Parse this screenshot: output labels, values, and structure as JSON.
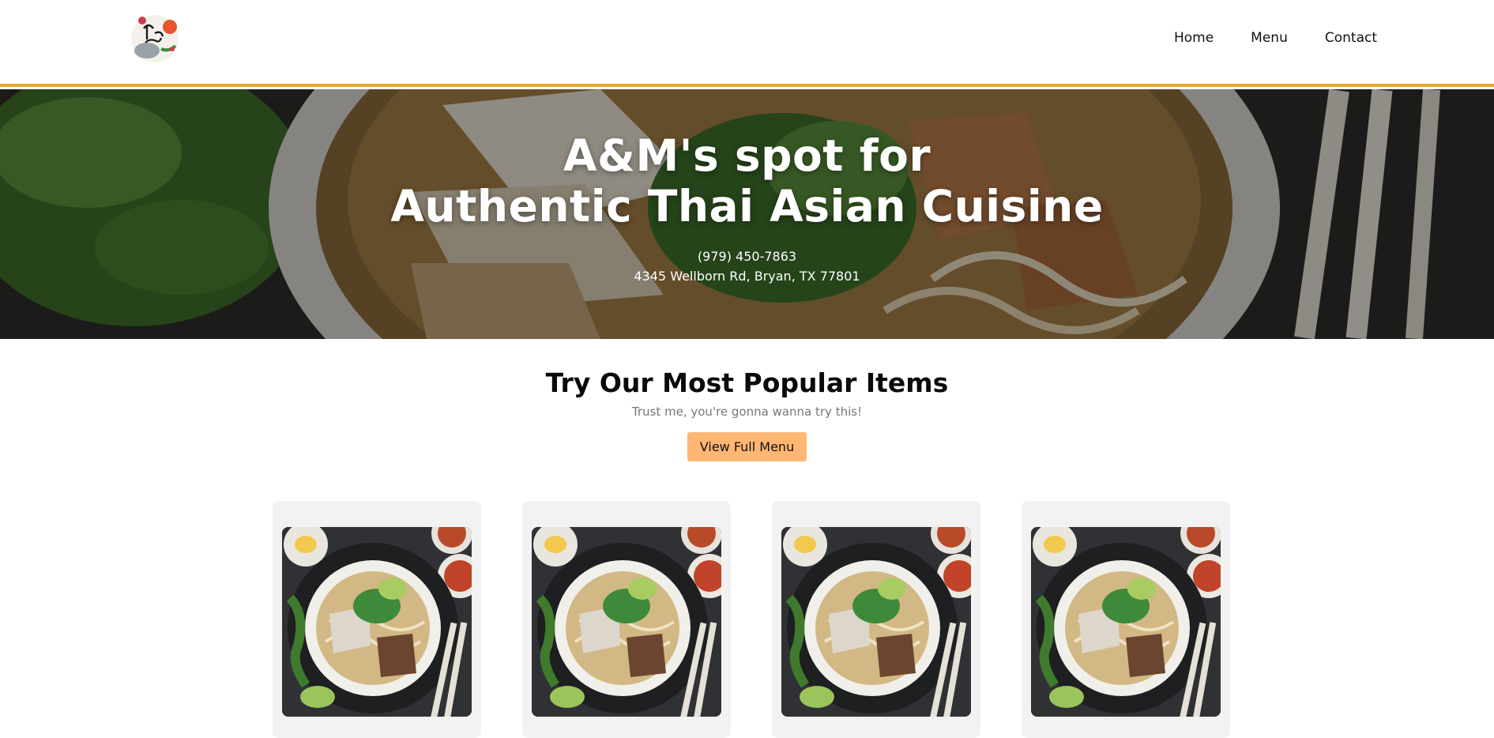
{
  "header": {
    "logo_alt": "Thai Food",
    "nav": [
      {
        "label": "Home"
      },
      {
        "label": "Menu"
      },
      {
        "label": "Contact"
      }
    ]
  },
  "hero": {
    "title_line1": "A&M's spot for",
    "title_line2": "Authentic Thai Asian Cuisine",
    "phone": "(979) 450-7863",
    "address": "4345 Wellborn Rd, Bryan, TX 77801"
  },
  "popular": {
    "title": "Try Our Most Popular Items",
    "subtitle": "Trust me, you're gonna wanna try this!",
    "button_label": "View Full Menu",
    "items": [
      {
        "image": "noodle-soup-bowl"
      },
      {
        "image": "noodle-soup-bowl"
      },
      {
        "image": "noodle-soup-bowl"
      },
      {
        "image": "noodle-soup-bowl"
      }
    ]
  },
  "colors": {
    "accent_border": "#e7a72b",
    "button_bg": "#ffb673",
    "card_bg": "#f2f2f2"
  }
}
